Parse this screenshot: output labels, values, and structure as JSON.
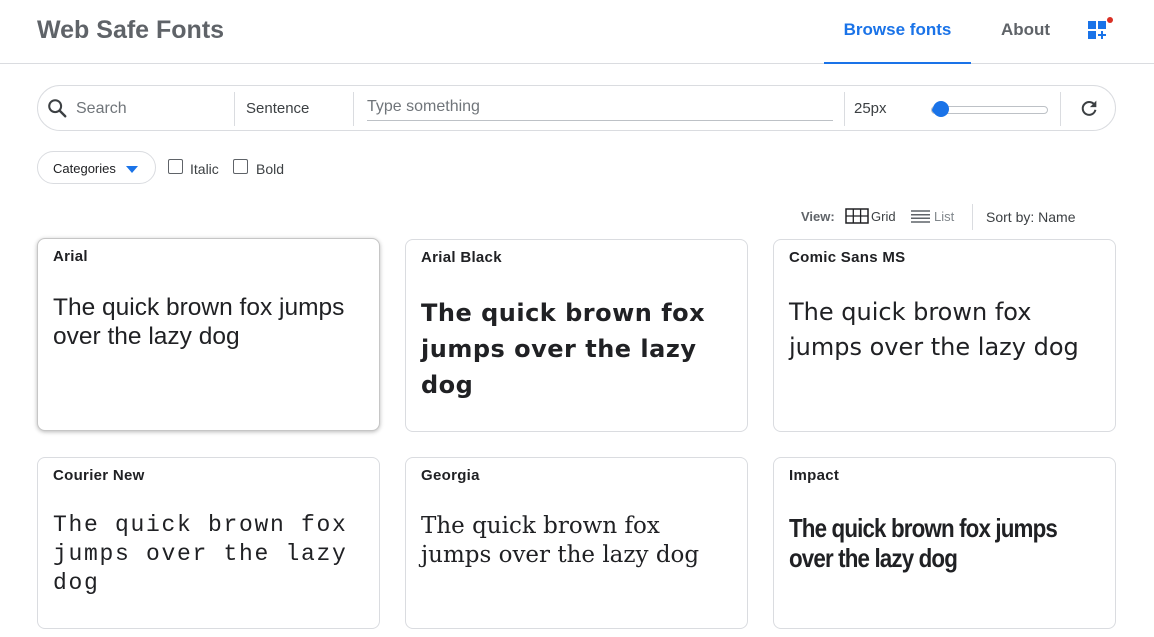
{
  "app": {
    "title": "Web Safe Fonts"
  },
  "nav": {
    "browse_label": "Browse fonts",
    "about_label": "About",
    "apps_icon": "apps-add-icon"
  },
  "toolbar": {
    "search_placeholder": "Search",
    "mode": "Sentence",
    "type_placeholder": "Type something",
    "size_label": "25px",
    "size_slider_fraction": 0.08,
    "reset_icon": "refresh-icon"
  },
  "filters": {
    "categories_label": "Categories",
    "italic_label": "Italic",
    "bold_label": "Bold",
    "italic_checked": false,
    "bold_checked": false
  },
  "view": {
    "label": "View:",
    "grid_label": "Grid",
    "list_label": "List",
    "sort_label": "Sort by: Name",
    "selected": "grid"
  },
  "colors": {
    "accent": "#1a73e8",
    "notification_dot": "#d93025"
  },
  "sample_text": "The quick brown fox jumps over the lazy dog",
  "fonts": [
    {
      "name": "Arial",
      "sample": "The quick brown fox jumps over the lazy dog"
    },
    {
      "name": "Arial Black",
      "sample": "The quick brown fox jumps over the lazy dog"
    },
    {
      "name": "Comic Sans MS",
      "sample": "The quick brown fox jumps over the lazy dog"
    },
    {
      "name": "Courier New",
      "sample": "The quick brown fox jumps over the lazy dog"
    },
    {
      "name": "Georgia",
      "sample": "The quick brown fox jumps over the lazy dog"
    },
    {
      "name": "Impact",
      "sample": "The quick brown fox jumps over the lazy dog"
    }
  ]
}
